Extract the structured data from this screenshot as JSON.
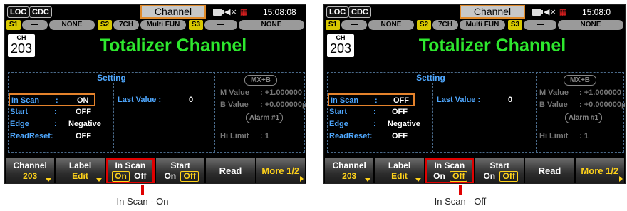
{
  "screens": [
    {
      "status": {
        "loc": "LOC",
        "cdc": "CDC",
        "title": "Channel",
        "time": "15:08:08"
      },
      "slots": [
        {
          "id": "S1",
          "value": "—"
        },
        {
          "value": "NONE"
        },
        {
          "id": "S2",
          "value": "7CH"
        },
        {
          "value": "Multi FUN"
        },
        {
          "id": "S3",
          "value": "—"
        },
        {
          "value": "NONE"
        }
      ],
      "channel": {
        "label": "CH",
        "number": "203",
        "title": "Totalizer Channel"
      },
      "setting": {
        "header": "Setting",
        "rows": [
          {
            "label": "In Scan",
            "value": "ON"
          },
          {
            "label": "Start",
            "value": "OFF"
          },
          {
            "label": "Edge",
            "value": "Negative"
          },
          {
            "label": "ReadReset:",
            "value": "OFF"
          }
        ],
        "last_value_label": "Last Value :",
        "last_value": "0"
      },
      "math": {
        "mxb": "MX+B",
        "m_label": "M Value",
        "m_value": ": +1.000000",
        "b_label": "B Value",
        "b_value": ": +0.000000µ",
        "alarm": "Alarm #1",
        "hi_label": "Hi Limit",
        "hi_value": ":      1"
      },
      "softkeys": [
        {
          "line1": "Channel",
          "line2": "203"
        },
        {
          "line1": "Label",
          "line2": "Edit"
        },
        {
          "line1": "In Scan",
          "opt_on": "On",
          "opt_off": "Off",
          "selected": "on"
        },
        {
          "line1": "Start",
          "opt_on": "On",
          "opt_off": "Off",
          "selected": "off"
        },
        {
          "single": "Read"
        },
        {
          "single": "More 1/2"
        }
      ],
      "caption": "In Scan - On"
    },
    {
      "status": {
        "loc": "LOC",
        "cdc": "CDC",
        "title": "Channel",
        "time": "15:08:0"
      },
      "slots": [
        {
          "id": "S1",
          "value": "—"
        },
        {
          "value": "NONE"
        },
        {
          "id": "S2",
          "value": "7CH"
        },
        {
          "value": "Multi FUN"
        },
        {
          "id": "S3",
          "value": "—"
        },
        {
          "value": "NONE"
        }
      ],
      "channel": {
        "label": "CH",
        "number": "203",
        "title": "Totalizer Channel"
      },
      "setting": {
        "header": "Setting",
        "rows": [
          {
            "label": "In Scan",
            "value": "OFF"
          },
          {
            "label": "Start",
            "value": "OFF"
          },
          {
            "label": "Edge",
            "value": "Negative"
          },
          {
            "label": "ReadReset:",
            "value": "OFF"
          }
        ],
        "last_value_label": "Last Value :",
        "last_value": "0"
      },
      "math": {
        "mxb": "MX+B",
        "m_label": "M Value",
        "m_value": ": +1.000000",
        "b_label": "B Value",
        "b_value": ": +0.000000µ",
        "alarm": "Alarm #1",
        "hi_label": "Hi Limit",
        "hi_value": ":      1"
      },
      "softkeys": [
        {
          "line1": "Channel",
          "line2": "203"
        },
        {
          "line1": "Label",
          "line2": "Edit"
        },
        {
          "line1": "In Scan",
          "opt_on": "On",
          "opt_off": "Off",
          "selected": "off"
        },
        {
          "line1": "Start",
          "opt_on": "On",
          "opt_off": "Off",
          "selected": "off"
        },
        {
          "single": "Read"
        },
        {
          "single": "More 1/2"
        }
      ],
      "caption": "In Scan - Off"
    }
  ],
  "colors": {
    "accent_green": "#2ee82e",
    "label_blue": "#4fa8ff",
    "highlight_orange": "#e5832c",
    "callout_red": "#e00000",
    "key_yellow": "#ffd21a"
  }
}
